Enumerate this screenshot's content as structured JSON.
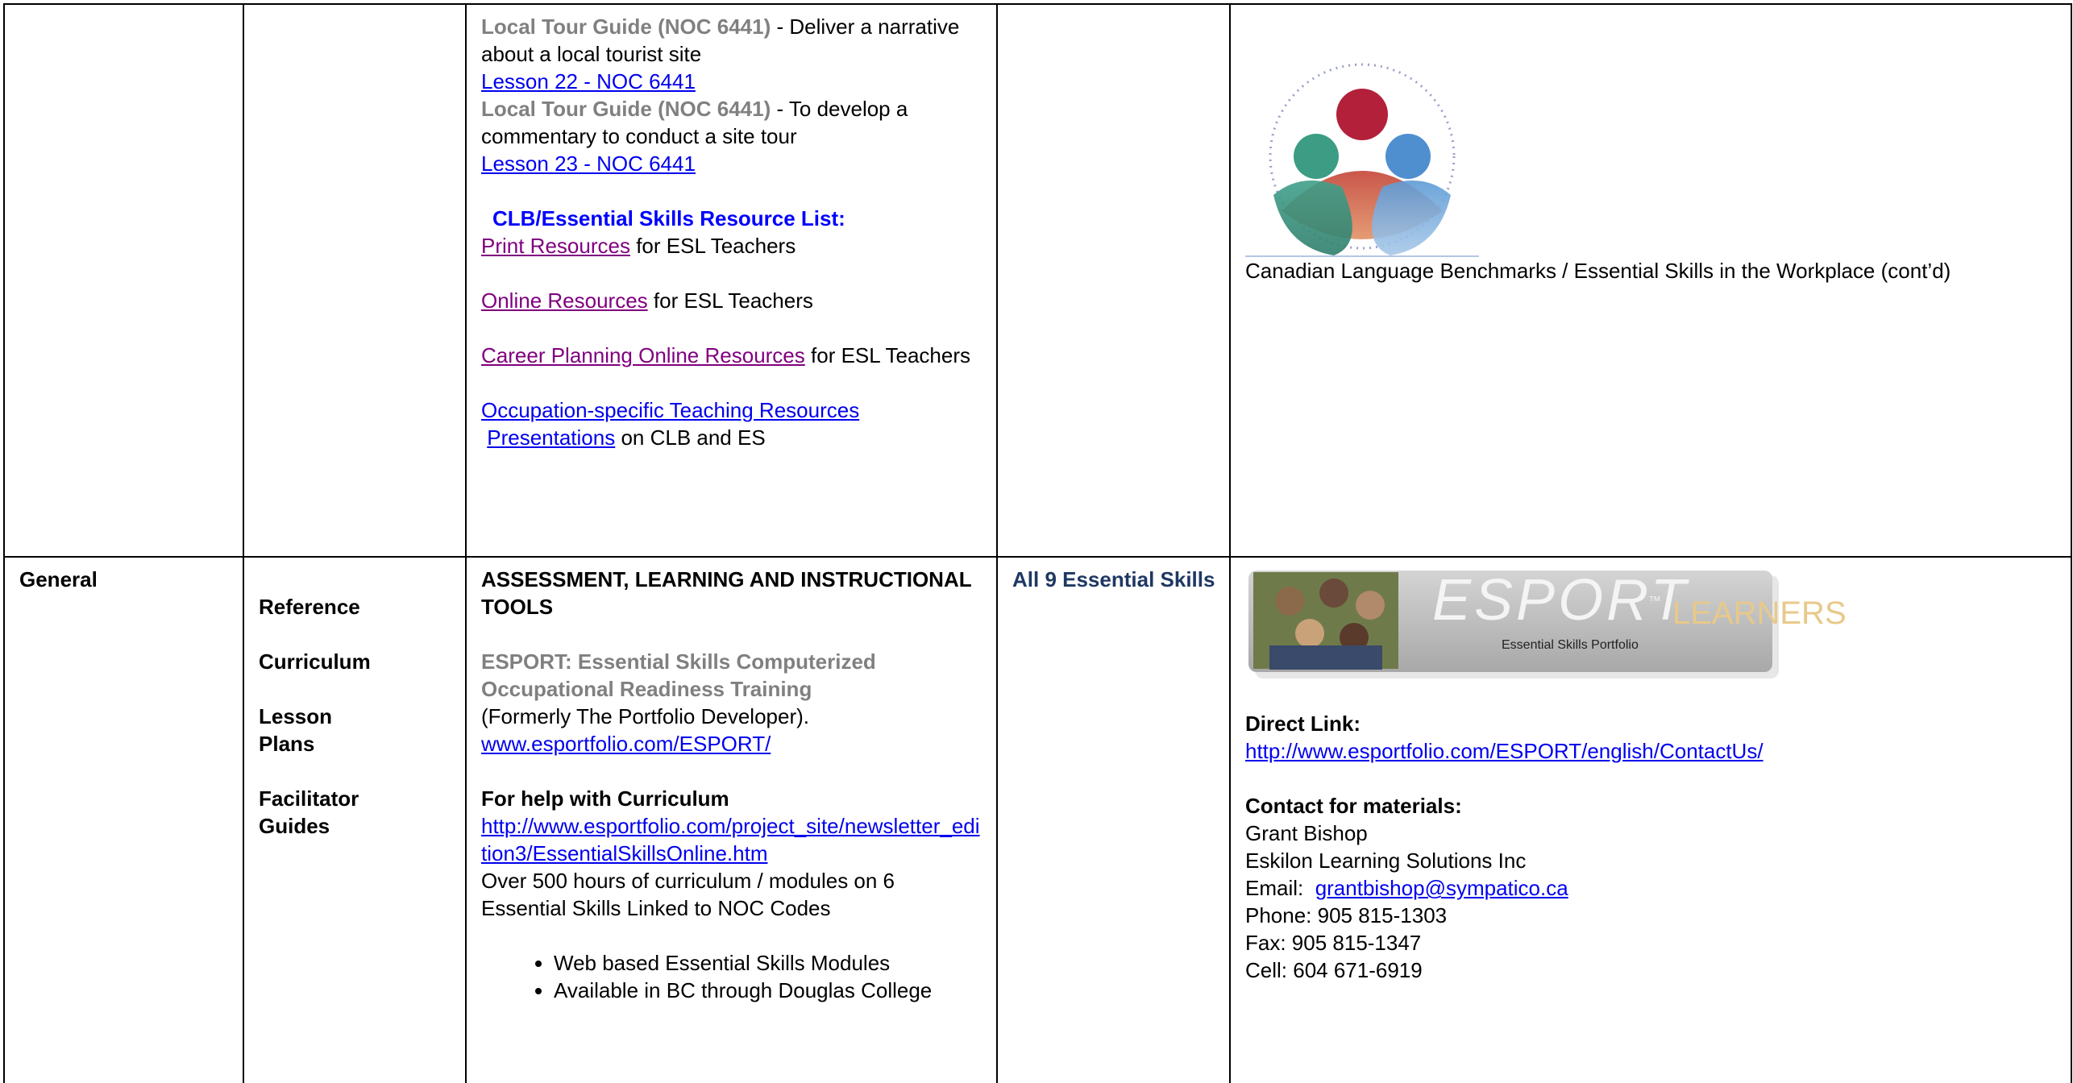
{
  "row1": {
    "col3": {
      "item1_title": "Local Tour Guide (NOC 6441)",
      "item1_text": " - Deliver a narrative about a local tourist site",
      "item1_link": "Lesson 22 - NOC 6441",
      "item2_title": "Local Tour Guide (NOC 6441)",
      "item2_text": " - To develop a commentary to conduct a site tour",
      "item2_link": "Lesson 23 - NOC 6441",
      "resource_heading": "CLB/Essential Skills Resource List:",
      "print_link": "Print Resources",
      "print_suffix": " for ESL Teachers",
      "online_link": "Online Resources",
      "online_suffix": " for ESL Teachers",
      "career_link": "Career Planning Online Resources",
      "career_suffix": " for ESL Teachers",
      "occupation_link": "Occupation-specific Teaching Resources",
      "presentations_link": "Presentations",
      "presentations_suffix": " on CLB and ES"
    },
    "col5": {
      "caption": "Canadian Language Benchmarks / Essential Skills in the Workplace (cont’d)"
    }
  },
  "row2": {
    "col1": {
      "category": "General"
    },
    "col2": {
      "types": [
        "Reference",
        "Curriculum",
        "Lesson Plans",
        "Facilitator Guides"
      ]
    },
    "col3": {
      "heading": "ASSESSMENT, LEARNING AND INSTRUCTIONAL TOOLS",
      "esport_title": "ESPORT: Essential Skills Computerized Occupational Readiness Training",
      "formerly": "(Formerly The Portfolio Developer).",
      "esport_link": "www.esportfolio.com/ESPORT/",
      "help_heading": "For help with Curriculum",
      "help_link": "http://www.esportfolio.com/project_site/newsletter_edition3/EssentialSkillsOnline.htm",
      "over_text": "Over 500 hours of curriculum / modules on 6 Essential Skills Linked to NOC Codes",
      "bullets": [
        "Web based Essential Skills Modules",
        "Available in BC through Douglas College"
      ]
    },
    "col4": {
      "skills": "All 9 Essential Skills"
    },
    "col5": {
      "banner_main": "ESPORT",
      "banner_tm": "™",
      "banner_sub": "Essential Skills Portfolio",
      "banner_right": "LEARNERS",
      "direct_heading": "Direct Link:",
      "direct_link": "http://www.esportfolio.com/ESPORT/english/ContactUs/",
      "contact_heading": "Contact for materials:",
      "contact_name": "Grant Bishop",
      "contact_org": "Eskilon Learning Solutions Inc",
      "email_label": "Email:  ",
      "email_link": "grantbishop@sympatico.ca",
      "phone": "Phone: 905 815-1303",
      "fax": "Fax:  905 815-1347",
      "cell": "Cell:  604 671-6919"
    }
  },
  "colors": {
    "link": "#0000ee",
    "visited_link": "#800080",
    "heading_blue": "#0000ff",
    "navy": "#1f3864",
    "gray": "#808080"
  }
}
